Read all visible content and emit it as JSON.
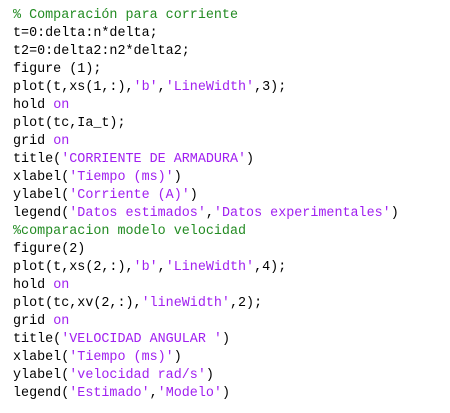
{
  "colors": {
    "default": "#000000",
    "comment": "#228b22",
    "keyword": "#0000ff",
    "string": "#a020f0"
  },
  "code": {
    "lines": [
      [
        {
          "t": "% Comparación para corriente",
          "c": "comment"
        }
      ],
      [
        {
          "t": "t=0:delta:n*delta;",
          "c": "default"
        }
      ],
      [
        {
          "t": "t2=0:delta2:n2*delta2;",
          "c": "default"
        }
      ],
      [
        {
          "t": "figure (1);",
          "c": "default"
        }
      ],
      [
        {
          "t": "plot(t,xs(1,:),",
          "c": "default"
        },
        {
          "t": "'b'",
          "c": "string"
        },
        {
          "t": ",",
          "c": "default"
        },
        {
          "t": "'LineWidth'",
          "c": "string"
        },
        {
          "t": ",3);",
          "c": "default"
        }
      ],
      [
        {
          "t": "hold ",
          "c": "default"
        },
        {
          "t": "on",
          "c": "string"
        }
      ],
      [
        {
          "t": "plot(tc,Ia_t);",
          "c": "default"
        }
      ],
      [
        {
          "t": "grid ",
          "c": "default"
        },
        {
          "t": "on",
          "c": "string"
        }
      ],
      [
        {
          "t": "title(",
          "c": "default"
        },
        {
          "t": "'CORRIENTE DE ARMADURA'",
          "c": "string"
        },
        {
          "t": ")",
          "c": "default"
        }
      ],
      [
        {
          "t": "xlabel(",
          "c": "default"
        },
        {
          "t": "'Tiempo (ms)'",
          "c": "string"
        },
        {
          "t": ")",
          "c": "default"
        }
      ],
      [
        {
          "t": "ylabel(",
          "c": "default"
        },
        {
          "t": "'Corriente (A)'",
          "c": "string"
        },
        {
          "t": ")",
          "c": "default"
        }
      ],
      [
        {
          "t": "legend(",
          "c": "default"
        },
        {
          "t": "'Datos estimados'",
          "c": "string"
        },
        {
          "t": ",",
          "c": "default"
        },
        {
          "t": "'Datos experimentales'",
          "c": "string"
        },
        {
          "t": ")",
          "c": "default"
        }
      ],
      [
        {
          "t": "%comparacion modelo velocidad",
          "c": "comment"
        }
      ],
      [
        {
          "t": "figure(2)",
          "c": "default"
        }
      ],
      [
        {
          "t": "plot(t,xs(2,:),",
          "c": "default"
        },
        {
          "t": "'b'",
          "c": "string"
        },
        {
          "t": ",",
          "c": "default"
        },
        {
          "t": "'LineWidth'",
          "c": "string"
        },
        {
          "t": ",4);",
          "c": "default"
        }
      ],
      [
        {
          "t": "hold ",
          "c": "default"
        },
        {
          "t": "on",
          "c": "string"
        }
      ],
      [
        {
          "t": "plot(tc,xv(2,:),",
          "c": "default"
        },
        {
          "t": "'lineWidth'",
          "c": "string"
        },
        {
          "t": ",2);",
          "c": "default"
        }
      ],
      [
        {
          "t": "grid ",
          "c": "default"
        },
        {
          "t": "on",
          "c": "string"
        }
      ],
      [
        {
          "t": "title(",
          "c": "default"
        },
        {
          "t": "'VELOCIDAD ANGULAR '",
          "c": "string"
        },
        {
          "t": ")",
          "c": "default"
        }
      ],
      [
        {
          "t": "xlabel(",
          "c": "default"
        },
        {
          "t": "'Tiempo (ms)'",
          "c": "string"
        },
        {
          "t": ")",
          "c": "default"
        }
      ],
      [
        {
          "t": "ylabel(",
          "c": "default"
        },
        {
          "t": "'velocidad rad/s'",
          "c": "string"
        },
        {
          "t": ")",
          "c": "default"
        }
      ],
      [
        {
          "t": "legend(",
          "c": "default"
        },
        {
          "t": "'Estimado'",
          "c": "string"
        },
        {
          "t": ",",
          "c": "default"
        },
        {
          "t": "'Modelo'",
          "c": "string"
        },
        {
          "t": ")",
          "c": "default"
        }
      ]
    ]
  }
}
